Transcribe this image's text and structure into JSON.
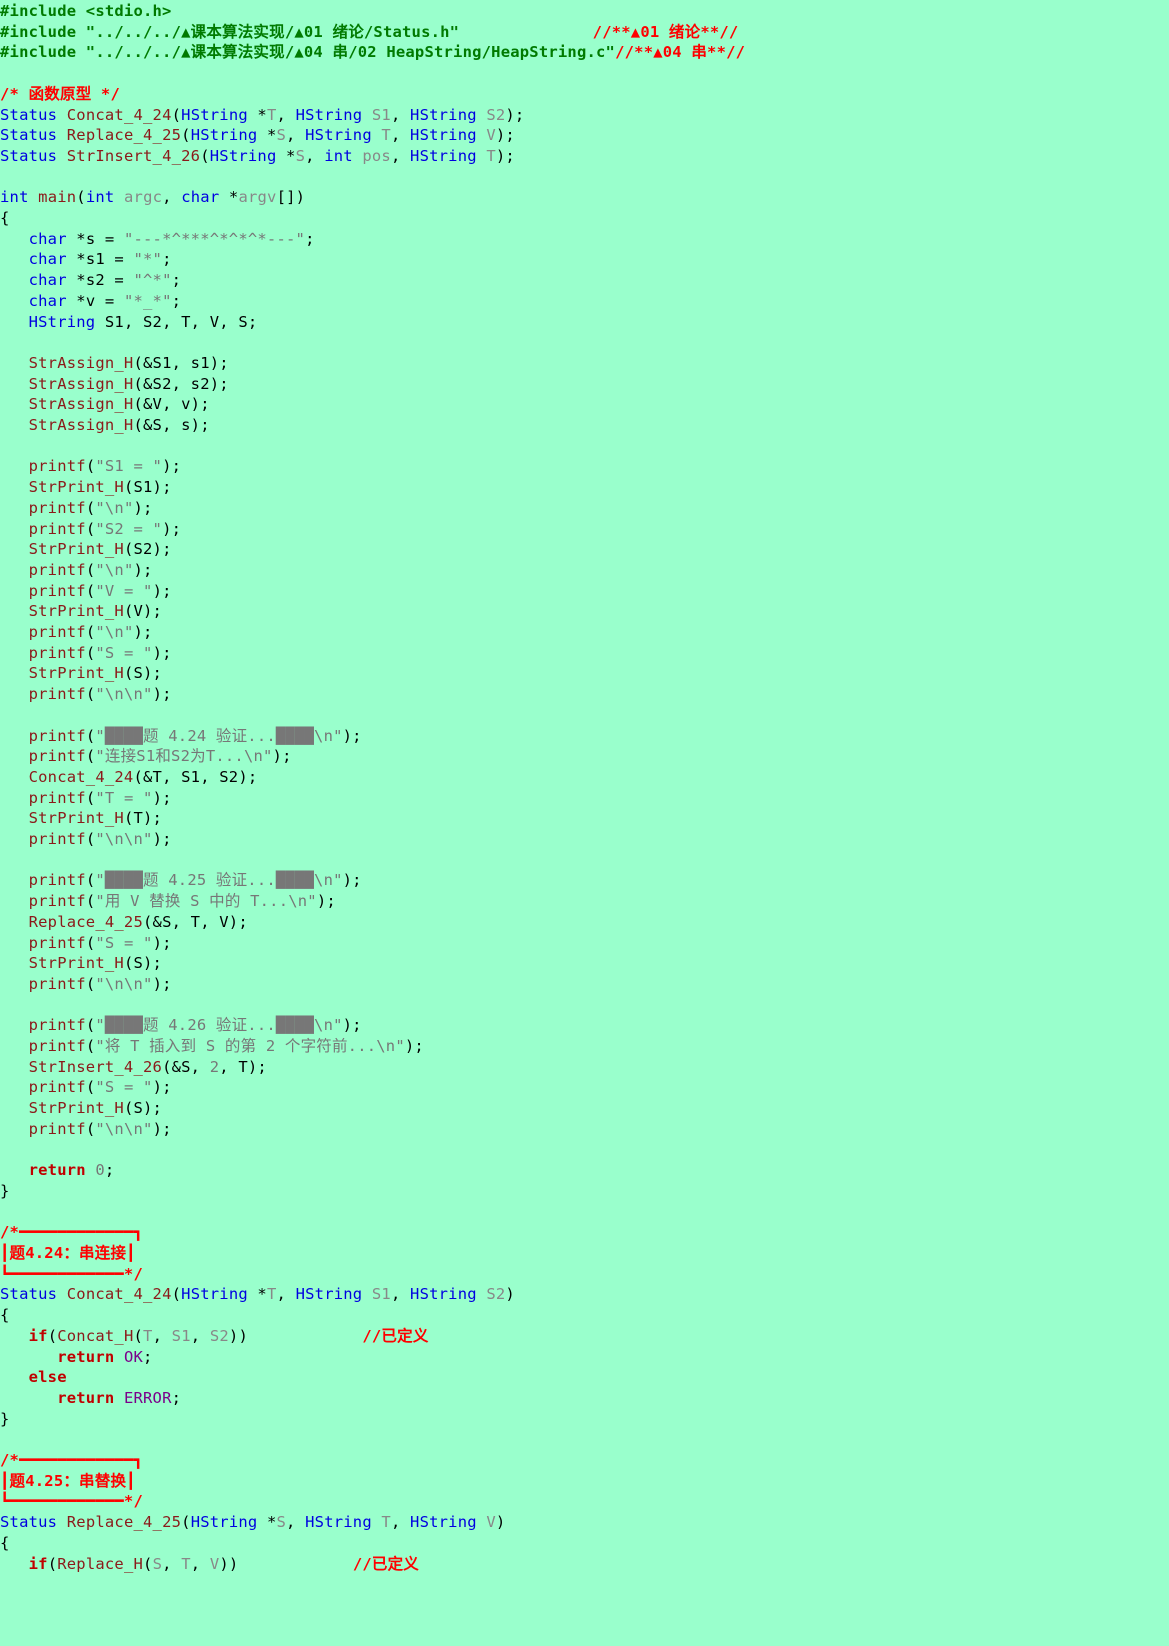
{
  "editor": {
    "lines": [
      [
        [
          "pre",
          "#include <stdio.h>"
        ]
      ],
      [
        [
          "pre",
          "#include \"../../../▲课本算法实现/▲01 绪论/Status.h\"              "
        ],
        [
          "cm",
          "//**▲01 绪论**//"
        ]
      ],
      [
        [
          "pre",
          "#include \"../../../▲课本算法实现/▲04 串/02 HeapString/HeapString.c\""
        ],
        [
          "cm",
          "//**▲04 串**//"
        ]
      ],
      [],
      [
        [
          "cm",
          "/* 函数原型 */"
        ]
      ],
      [
        [
          "ty",
          "Status"
        ],
        [
          "pun",
          " "
        ],
        [
          "fn",
          "Concat_4_24"
        ],
        [
          "pun",
          "("
        ],
        [
          "ty",
          "HString"
        ],
        [
          "pun",
          " *"
        ],
        [
          "par",
          "T"
        ],
        [
          "pun",
          ", "
        ],
        [
          "ty",
          "HString"
        ],
        [
          "pun",
          " "
        ],
        [
          "par",
          "S1"
        ],
        [
          "pun",
          ", "
        ],
        [
          "ty",
          "HString"
        ],
        [
          "pun",
          " "
        ],
        [
          "par",
          "S2"
        ],
        [
          "pun",
          ");"
        ]
      ],
      [
        [
          "ty",
          "Status"
        ],
        [
          "pun",
          " "
        ],
        [
          "fn",
          "Replace_4_25"
        ],
        [
          "pun",
          "("
        ],
        [
          "ty",
          "HString"
        ],
        [
          "pun",
          " *"
        ],
        [
          "par",
          "S"
        ],
        [
          "pun",
          ", "
        ],
        [
          "ty",
          "HString"
        ],
        [
          "pun",
          " "
        ],
        [
          "par",
          "T"
        ],
        [
          "pun",
          ", "
        ],
        [
          "ty",
          "HString"
        ],
        [
          "pun",
          " "
        ],
        [
          "par",
          "V"
        ],
        [
          "pun",
          ");"
        ]
      ],
      [
        [
          "ty",
          "Status"
        ],
        [
          "pun",
          " "
        ],
        [
          "fn",
          "StrInsert_4_26"
        ],
        [
          "pun",
          "("
        ],
        [
          "ty",
          "HString"
        ],
        [
          "pun",
          " *"
        ],
        [
          "par",
          "S"
        ],
        [
          "pun",
          ", "
        ],
        [
          "ty",
          "int"
        ],
        [
          "pun",
          " "
        ],
        [
          "par",
          "pos"
        ],
        [
          "pun",
          ", "
        ],
        [
          "ty",
          "HString"
        ],
        [
          "pun",
          " "
        ],
        [
          "par",
          "T"
        ],
        [
          "pun",
          ");"
        ]
      ],
      [],
      [
        [
          "ty",
          "int"
        ],
        [
          "pun",
          " "
        ],
        [
          "fn",
          "main"
        ],
        [
          "pun",
          "("
        ],
        [
          "ty",
          "int"
        ],
        [
          "pun",
          " "
        ],
        [
          "par",
          "argc"
        ],
        [
          "pun",
          ", "
        ],
        [
          "ty",
          "char"
        ],
        [
          "pun",
          " *"
        ],
        [
          "par",
          "argv"
        ],
        [
          "pun",
          "[])"
        ]
      ],
      [
        [
          "pun",
          "{"
        ]
      ],
      [
        [
          "pun",
          "   "
        ],
        [
          "ty",
          "char"
        ],
        [
          "pun",
          " *s = "
        ],
        [
          "str",
          "\"---*^***^*^*^*---\""
        ],
        [
          "pun",
          ";"
        ]
      ],
      [
        [
          "pun",
          "   "
        ],
        [
          "ty",
          "char"
        ],
        [
          "pun",
          " *s1 = "
        ],
        [
          "str",
          "\"*\""
        ],
        [
          "pun",
          ";"
        ]
      ],
      [
        [
          "pun",
          "   "
        ],
        [
          "ty",
          "char"
        ],
        [
          "pun",
          " *s2 = "
        ],
        [
          "str",
          "\"^*\""
        ],
        [
          "pun",
          ";"
        ]
      ],
      [
        [
          "pun",
          "   "
        ],
        [
          "ty",
          "char"
        ],
        [
          "pun",
          " *v = "
        ],
        [
          "str",
          "\"*_*\""
        ],
        [
          "pun",
          ";"
        ]
      ],
      [
        [
          "pun",
          "   "
        ],
        [
          "ty",
          "HString"
        ],
        [
          "pun",
          " S1, S2, T, V, S;"
        ]
      ],
      [],
      [
        [
          "pun",
          "   "
        ],
        [
          "fn",
          "StrAssign_H"
        ],
        [
          "pun",
          "(&S1, s1);"
        ]
      ],
      [
        [
          "pun",
          "   "
        ],
        [
          "fn",
          "StrAssign_H"
        ],
        [
          "pun",
          "(&S2, s2);"
        ]
      ],
      [
        [
          "pun",
          "   "
        ],
        [
          "fn",
          "StrAssign_H"
        ],
        [
          "pun",
          "(&V, v);"
        ]
      ],
      [
        [
          "pun",
          "   "
        ],
        [
          "fn",
          "StrAssign_H"
        ],
        [
          "pun",
          "(&S, s);"
        ]
      ],
      [],
      [
        [
          "pun",
          "   "
        ],
        [
          "fn",
          "printf"
        ],
        [
          "pun",
          "("
        ],
        [
          "str",
          "\"S1 = \""
        ],
        [
          "pun",
          ");"
        ]
      ],
      [
        [
          "pun",
          "   "
        ],
        [
          "fn",
          "StrPrint_H"
        ],
        [
          "pun",
          "(S1);"
        ]
      ],
      [
        [
          "pun",
          "   "
        ],
        [
          "fn",
          "printf"
        ],
        [
          "pun",
          "("
        ],
        [
          "str",
          "\"\\n\""
        ],
        [
          "pun",
          ");"
        ]
      ],
      [
        [
          "pun",
          "   "
        ],
        [
          "fn",
          "printf"
        ],
        [
          "pun",
          "("
        ],
        [
          "str",
          "\"S2 = \""
        ],
        [
          "pun",
          ");"
        ]
      ],
      [
        [
          "pun",
          "   "
        ],
        [
          "fn",
          "StrPrint_H"
        ],
        [
          "pun",
          "(S2);"
        ]
      ],
      [
        [
          "pun",
          "   "
        ],
        [
          "fn",
          "printf"
        ],
        [
          "pun",
          "("
        ],
        [
          "str",
          "\"\\n\""
        ],
        [
          "pun",
          ");"
        ]
      ],
      [
        [
          "pun",
          "   "
        ],
        [
          "fn",
          "printf"
        ],
        [
          "pun",
          "("
        ],
        [
          "str",
          "\"V = \""
        ],
        [
          "pun",
          ");"
        ]
      ],
      [
        [
          "pun",
          "   "
        ],
        [
          "fn",
          "StrPrint_H"
        ],
        [
          "pun",
          "(V);"
        ]
      ],
      [
        [
          "pun",
          "   "
        ],
        [
          "fn",
          "printf"
        ],
        [
          "pun",
          "("
        ],
        [
          "str",
          "\"\\n\""
        ],
        [
          "pun",
          ");"
        ]
      ],
      [
        [
          "pun",
          "   "
        ],
        [
          "fn",
          "printf"
        ],
        [
          "pun",
          "("
        ],
        [
          "str",
          "\"S = \""
        ],
        [
          "pun",
          ");"
        ]
      ],
      [
        [
          "pun",
          "   "
        ],
        [
          "fn",
          "StrPrint_H"
        ],
        [
          "pun",
          "(S);"
        ]
      ],
      [
        [
          "pun",
          "   "
        ],
        [
          "fn",
          "printf"
        ],
        [
          "pun",
          "("
        ],
        [
          "str",
          "\"\\n\\n\""
        ],
        [
          "pun",
          ");"
        ]
      ],
      [],
      [
        [
          "pun",
          "   "
        ],
        [
          "fn",
          "printf"
        ],
        [
          "pun",
          "("
        ],
        [
          "str",
          "\"████题 4.24 验证...████\\n\""
        ],
        [
          "pun",
          ");"
        ]
      ],
      [
        [
          "pun",
          "   "
        ],
        [
          "fn",
          "printf"
        ],
        [
          "pun",
          "("
        ],
        [
          "str",
          "\"连接S1和S2为T...\\n\""
        ],
        [
          "pun",
          ");"
        ]
      ],
      [
        [
          "pun",
          "   "
        ],
        [
          "fn",
          "Concat_4_24"
        ],
        [
          "pun",
          "(&T, S1, S2);"
        ]
      ],
      [
        [
          "pun",
          "   "
        ],
        [
          "fn",
          "printf"
        ],
        [
          "pun",
          "("
        ],
        [
          "str",
          "\"T = \""
        ],
        [
          "pun",
          ");"
        ]
      ],
      [
        [
          "pun",
          "   "
        ],
        [
          "fn",
          "StrPrint_H"
        ],
        [
          "pun",
          "(T);"
        ]
      ],
      [
        [
          "pun",
          "   "
        ],
        [
          "fn",
          "printf"
        ],
        [
          "pun",
          "("
        ],
        [
          "str",
          "\"\\n\\n\""
        ],
        [
          "pun",
          ");"
        ]
      ],
      [],
      [
        [
          "pun",
          "   "
        ],
        [
          "fn",
          "printf"
        ],
        [
          "pun",
          "("
        ],
        [
          "str",
          "\"████题 4.25 验证...████\\n\""
        ],
        [
          "pun",
          ");"
        ]
      ],
      [
        [
          "pun",
          "   "
        ],
        [
          "fn",
          "printf"
        ],
        [
          "pun",
          "("
        ],
        [
          "str",
          "\"用 V 替换 S 中的 T...\\n\""
        ],
        [
          "pun",
          ");"
        ]
      ],
      [
        [
          "pun",
          "   "
        ],
        [
          "fn",
          "Replace_4_25"
        ],
        [
          "pun",
          "(&S, T, V);"
        ]
      ],
      [
        [
          "pun",
          "   "
        ],
        [
          "fn",
          "printf"
        ],
        [
          "pun",
          "("
        ],
        [
          "str",
          "\"S = \""
        ],
        [
          "pun",
          ");"
        ]
      ],
      [
        [
          "pun",
          "   "
        ],
        [
          "fn",
          "StrPrint_H"
        ],
        [
          "pun",
          "(S);"
        ]
      ],
      [
        [
          "pun",
          "   "
        ],
        [
          "fn",
          "printf"
        ],
        [
          "pun",
          "("
        ],
        [
          "str",
          "\"\\n\\n\""
        ],
        [
          "pun",
          ");"
        ]
      ],
      [],
      [
        [
          "pun",
          "   "
        ],
        [
          "fn",
          "printf"
        ],
        [
          "pun",
          "("
        ],
        [
          "str",
          "\"████题 4.26 验证...████\\n\""
        ],
        [
          "pun",
          ");"
        ]
      ],
      [
        [
          "pun",
          "   "
        ],
        [
          "fn",
          "printf"
        ],
        [
          "pun",
          "("
        ],
        [
          "str",
          "\"将 T 插入到 S 的第 2 个字符前...\\n\""
        ],
        [
          "pun",
          ");"
        ]
      ],
      [
        [
          "pun",
          "   "
        ],
        [
          "fn",
          "StrInsert_4_26"
        ],
        [
          "pun",
          "(&S, "
        ],
        [
          "num",
          "2"
        ],
        [
          "pun",
          ", T);"
        ]
      ],
      [
        [
          "pun",
          "   "
        ],
        [
          "fn",
          "printf"
        ],
        [
          "pun",
          "("
        ],
        [
          "str",
          "\"S = \""
        ],
        [
          "pun",
          ");"
        ]
      ],
      [
        [
          "pun",
          "   "
        ],
        [
          "fn",
          "StrPrint_H"
        ],
        [
          "pun",
          "(S);"
        ]
      ],
      [
        [
          "pun",
          "   "
        ],
        [
          "fn",
          "printf"
        ],
        [
          "pun",
          "("
        ],
        [
          "str",
          "\"\\n\\n\""
        ],
        [
          "pun",
          ");"
        ]
      ],
      [],
      [
        [
          "pun",
          "   "
        ],
        [
          "kw",
          "return"
        ],
        [
          "pun",
          " "
        ],
        [
          "num",
          "0"
        ],
        [
          "pun",
          ";"
        ]
      ],
      [
        [
          "pun",
          "}"
        ]
      ],
      [],
      [
        [
          "cm",
          "/*━━━━━━━━━━━━┓"
        ]
      ],
      [
        [
          "cm",
          "┃题4.24：串连接┃"
        ]
      ],
      [
        [
          "cm",
          "┗━━━━━━━━━━━━*/"
        ]
      ],
      [
        [
          "ty",
          "Status"
        ],
        [
          "pun",
          " "
        ],
        [
          "fn",
          "Concat_4_24"
        ],
        [
          "pun",
          "("
        ],
        [
          "ty",
          "HString"
        ],
        [
          "pun",
          " *"
        ],
        [
          "par",
          "T"
        ],
        [
          "pun",
          ", "
        ],
        [
          "ty",
          "HString"
        ],
        [
          "pun",
          " "
        ],
        [
          "par",
          "S1"
        ],
        [
          "pun",
          ", "
        ],
        [
          "ty",
          "HString"
        ],
        [
          "pun",
          " "
        ],
        [
          "par",
          "S2"
        ],
        [
          "pun",
          ")"
        ]
      ],
      [
        [
          "pun",
          "{"
        ]
      ],
      [
        [
          "pun",
          "   "
        ],
        [
          "kw",
          "if"
        ],
        [
          "pun",
          "("
        ],
        [
          "fn",
          "Concat_H"
        ],
        [
          "pun",
          "("
        ],
        [
          "par",
          "T"
        ],
        [
          "pun",
          ", "
        ],
        [
          "par",
          "S1"
        ],
        [
          "pun",
          ", "
        ],
        [
          "par",
          "S2"
        ],
        [
          "pun",
          "))            "
        ],
        [
          "cm",
          "//已定义"
        ]
      ],
      [
        [
          "pun",
          "      "
        ],
        [
          "kw",
          "return"
        ],
        [
          "pun",
          " "
        ],
        [
          "mac",
          "OK"
        ],
        [
          "pun",
          ";"
        ]
      ],
      [
        [
          "pun",
          "   "
        ],
        [
          "kw",
          "else"
        ]
      ],
      [
        [
          "pun",
          "      "
        ],
        [
          "kw",
          "return"
        ],
        [
          "pun",
          " "
        ],
        [
          "mac",
          "ERROR"
        ],
        [
          "pun",
          ";"
        ]
      ],
      [
        [
          "pun",
          "}"
        ]
      ],
      [],
      [
        [
          "cm",
          "/*━━━━━━━━━━━━┓"
        ]
      ],
      [
        [
          "cm",
          "┃题4.25：串替换┃"
        ]
      ],
      [
        [
          "cm",
          "┗━━━━━━━━━━━━*/"
        ]
      ],
      [
        [
          "ty",
          "Status"
        ],
        [
          "pun",
          " "
        ],
        [
          "fn",
          "Replace_4_25"
        ],
        [
          "pun",
          "("
        ],
        [
          "ty",
          "HString"
        ],
        [
          "pun",
          " *"
        ],
        [
          "par",
          "S"
        ],
        [
          "pun",
          ", "
        ],
        [
          "ty",
          "HString"
        ],
        [
          "pun",
          " "
        ],
        [
          "par",
          "T"
        ],
        [
          "pun",
          ", "
        ],
        [
          "ty",
          "HString"
        ],
        [
          "pun",
          " "
        ],
        [
          "par",
          "V"
        ],
        [
          "pun",
          ")"
        ]
      ],
      [
        [
          "pun",
          "{"
        ]
      ],
      [
        [
          "pun",
          "   "
        ],
        [
          "kw",
          "if"
        ],
        [
          "pun",
          "("
        ],
        [
          "fn",
          "Replace_H"
        ],
        [
          "pun",
          "("
        ],
        [
          "par",
          "S"
        ],
        [
          "pun",
          ", "
        ],
        [
          "par",
          "T"
        ],
        [
          "pun",
          ", "
        ],
        [
          "par",
          "V"
        ],
        [
          "pun",
          "))            "
        ],
        [
          "cm",
          "//已定义"
        ]
      ]
    ]
  }
}
